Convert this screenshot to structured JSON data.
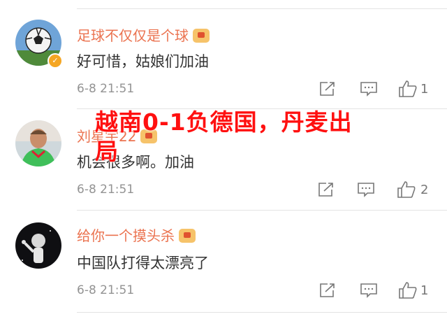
{
  "comments": [
    {
      "username": "足球不仅仅是个球",
      "text": "好可惜，姑娘们加油",
      "time": "6-8 21:51",
      "likes": "1",
      "verified": true
    },
    {
      "username": "刘星宇22",
      "text": "机会很多啊。加油",
      "time": "6-8 21:51",
      "likes": "2",
      "verified": false
    },
    {
      "username": "给你一个摸头杀",
      "text": "中国队打得太漂亮了",
      "time": "6-8 21:51",
      "likes": "1",
      "verified": false
    }
  ],
  "overlay_headline": "越南0-1负德国，丹麦出局",
  "icons": {
    "share": "share-icon",
    "comment": "comment-icon",
    "like": "thumbs-up-icon",
    "verified": "verified-badge-icon",
    "level": "level-badge-icon"
  },
  "colors": {
    "username": "#eb7350",
    "text": "#333333",
    "time": "#939393",
    "overlay": "#ff1010"
  }
}
